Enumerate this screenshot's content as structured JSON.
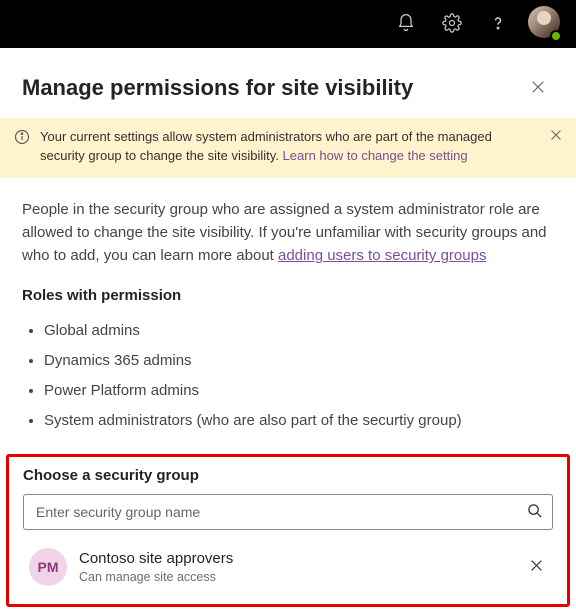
{
  "panel": {
    "title": "Manage permissions for site visibility"
  },
  "info": {
    "text_before_link": "Your current settings allow system administrators who are part of the managed security group to change the site visibility. ",
    "link_label": "Learn how to change the setting"
  },
  "body": {
    "text_before_link": "People in the security group who are assigned a system administrator role are allowed to change the site visibility. If you're unfamiliar with security groups and who to add, you can learn more about ",
    "link_label": "adding users to security groups"
  },
  "roles": {
    "heading": "Roles with permission",
    "items": [
      "Global admins",
      "Dynamics 365 admins",
      "Power Platform admins",
      "System administrators (who are also part of the securtiy group)"
    ]
  },
  "chooser": {
    "heading": "Choose a security group",
    "placeholder": "Enter security group name",
    "selected": {
      "initials": "PM",
      "name": "Contoso site approvers",
      "subtitle": "Can manage site access"
    }
  }
}
